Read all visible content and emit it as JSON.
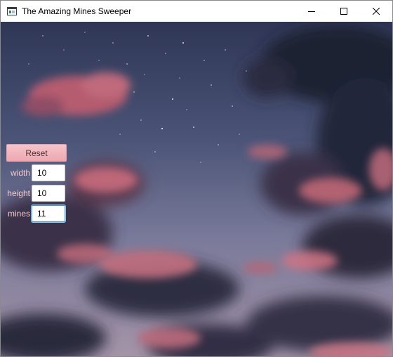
{
  "window": {
    "title": "The Amazing Mines Sweeper"
  },
  "controls": {
    "reset_label": "Reset",
    "fields": [
      {
        "label": "width",
        "value": "10"
      },
      {
        "label": "height",
        "value": "10"
      },
      {
        "label": "mines",
        "value": "11"
      }
    ],
    "focused_field": "mines"
  },
  "theme": {
    "button_color": "#f1b6bd",
    "label_color": "#f2c9cf",
    "focus_color": "#3d9be0"
  },
  "icons": {
    "title_bar": [
      "app-icon",
      "minimize-icon",
      "maximize-icon",
      "close-icon"
    ]
  }
}
